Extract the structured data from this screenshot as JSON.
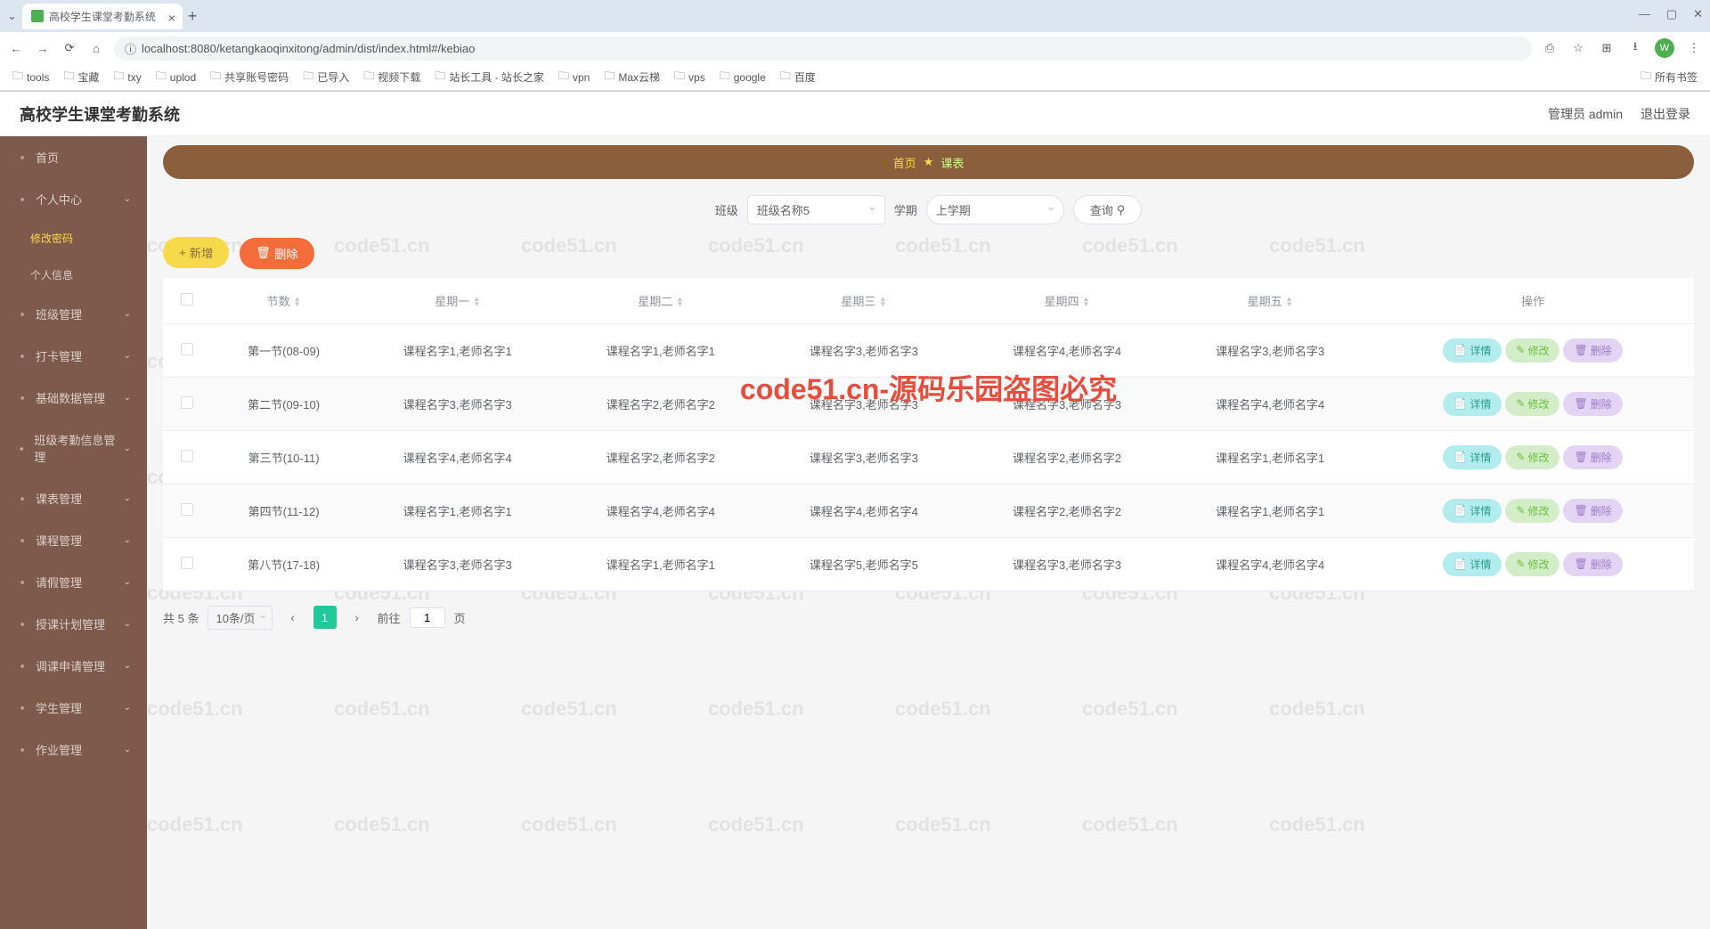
{
  "browser": {
    "tab_title": "高校学生课堂考勤系统",
    "url": "localhost:8080/ketangkaoqinxitong/admin/dist/index.html#/kebiao",
    "bookmarks": [
      "tools",
      "宝藏",
      "txy",
      "uplod",
      "共享账号密码",
      "已导入",
      "视频下载",
      "站长工具 - 站长之家",
      "vpn",
      "Max云梯",
      "vps",
      "google",
      "百度"
    ],
    "all_bookmarks": "所有书签",
    "avatar_letter": "W"
  },
  "header": {
    "title": "高校学生课堂考勤系统",
    "user": "管理员 admin",
    "logout": "退出登录"
  },
  "sidebar": {
    "items": [
      {
        "label": "首页"
      },
      {
        "label": "个人中心",
        "sub": [
          {
            "label": "修改密码",
            "active": true
          },
          {
            "label": "个人信息"
          }
        ]
      },
      {
        "label": "班级管理"
      },
      {
        "label": "打卡管理"
      },
      {
        "label": "基础数据管理"
      },
      {
        "label": "班级考勤信息管理"
      },
      {
        "label": "课表管理"
      },
      {
        "label": "课程管理"
      },
      {
        "label": "请假管理"
      },
      {
        "label": "授课计划管理"
      },
      {
        "label": "调课申请管理"
      },
      {
        "label": "学生管理"
      },
      {
        "label": "作业管理"
      }
    ]
  },
  "breadcrumb": {
    "home": "首页",
    "current": "课表"
  },
  "filters": {
    "class_label": "班级",
    "class_value": "班级名称5",
    "term_label": "学期",
    "term_value": "上学期",
    "query_label": "查询"
  },
  "actions": {
    "add": "新增",
    "delete": "删除"
  },
  "table": {
    "headers": [
      "节数",
      "星期一",
      "星期二",
      "星期三",
      "星期四",
      "星期五",
      "操作"
    ],
    "rows": [
      {
        "period": "第一节(08-09)",
        "mon": "课程名字1,老师名字1",
        "tue": "课程名字1,老师名字1",
        "wed": "课程名字3,老师名字3",
        "thu": "课程名字4,老师名字4",
        "fri": "课程名字3,老师名字3"
      },
      {
        "period": "第二节(09-10)",
        "mon": "课程名字3,老师名字3",
        "tue": "课程名字2,老师名字2",
        "wed": "课程名字3,老师名字3",
        "thu": "课程名字3,老师名字3",
        "fri": "课程名字4,老师名字4"
      },
      {
        "period": "第三节(10-11)",
        "mon": "课程名字4,老师名字4",
        "tue": "课程名字2,老师名字2",
        "wed": "课程名字3,老师名字3",
        "thu": "课程名字2,老师名字2",
        "fri": "课程名字1,老师名字1"
      },
      {
        "period": "第四节(11-12)",
        "mon": "课程名字1,老师名字1",
        "tue": "课程名字4,老师名字4",
        "wed": "课程名字4,老师名字4",
        "thu": "课程名字2,老师名字2",
        "fri": "课程名字1,老师名字1"
      },
      {
        "period": "第八节(17-18)",
        "mon": "课程名字3,老师名字3",
        "tue": "课程名字1,老师名字1",
        "wed": "课程名字5,老师名字5",
        "thu": "课程名字3,老师名字3",
        "fri": "课程名字4,老师名字4"
      }
    ],
    "op_detail": "详情",
    "op_edit": "修改",
    "op_delete": "删除"
  },
  "pagination": {
    "total": "共 5 条",
    "per_page": "10条/页",
    "current": "1",
    "goto": "前往",
    "goto_value": "1",
    "page_suffix": "页"
  },
  "watermark": {
    "text": "code51.cn",
    "red": "code51.cn-源码乐园盗图必究"
  }
}
